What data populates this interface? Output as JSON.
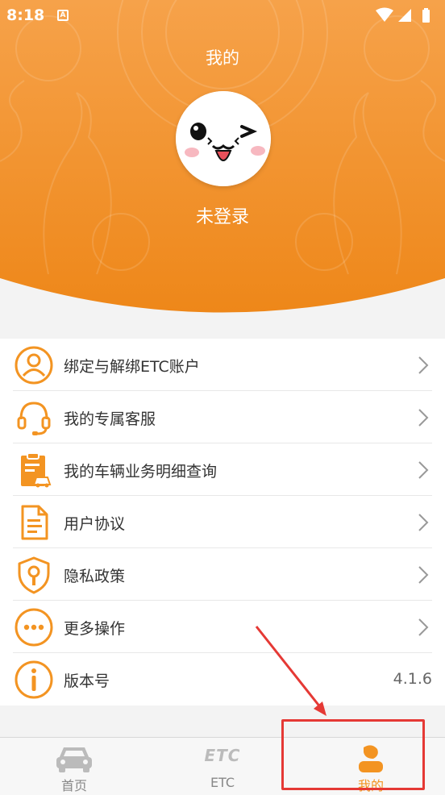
{
  "status": {
    "time": "8:18",
    "notification_glyph": "A"
  },
  "header": {
    "title": "我的",
    "login_text": "未登录"
  },
  "menu": [
    {
      "label": "绑定与解绑ETC账户",
      "icon": "user-icon"
    },
    {
      "label": "我的专属客服",
      "icon": "headset-icon"
    },
    {
      "label": "我的车辆业务明细查询",
      "icon": "clipboard-car-icon"
    },
    {
      "label": "用户协议",
      "icon": "document-icon"
    },
    {
      "label": "隐私政策",
      "icon": "shield-lock-icon"
    },
    {
      "label": "更多操作",
      "icon": "more-dots-icon"
    },
    {
      "label": "版本号",
      "icon": "info-icon",
      "value": "4.1.6"
    }
  ],
  "tabs": [
    {
      "label": "首页",
      "icon": "car-icon",
      "active": false
    },
    {
      "label": "ETC",
      "icon": "etc-logo-icon",
      "logo_text": "ETC",
      "active": false
    },
    {
      "label": "我的",
      "icon": "profile-icon",
      "active": true
    }
  ],
  "colors": {
    "accent": "#f39422",
    "header_top": "#f7a34a",
    "header_bottom": "#ef8a1a",
    "annotation": "#e53935"
  }
}
